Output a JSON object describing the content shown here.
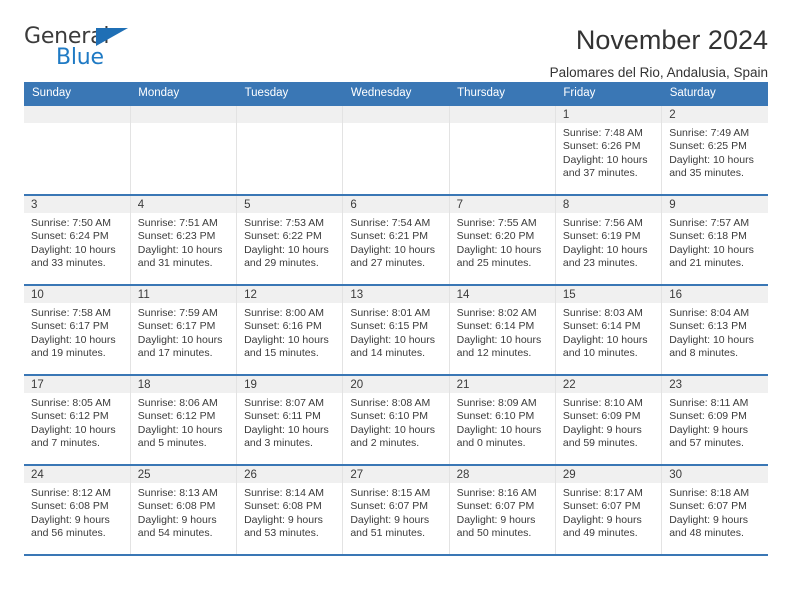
{
  "brand": {
    "name_part1": "General",
    "name_part2": "Blue"
  },
  "header": {
    "title": "November 2024",
    "subtitle": "Palomares del Rio, Andalusia, Spain"
  },
  "colors": {
    "header_blue": "#3a77b5",
    "brand_blue": "#1f7ac4",
    "daynum_band": "#f0f0f0",
    "text": "#3b3b3b"
  },
  "weekdays": [
    "Sunday",
    "Monday",
    "Tuesday",
    "Wednesday",
    "Thursday",
    "Friday",
    "Saturday"
  ],
  "weeks": [
    [
      {
        "day": "",
        "empty": true
      },
      {
        "day": "",
        "empty": true
      },
      {
        "day": "",
        "empty": true
      },
      {
        "day": "",
        "empty": true
      },
      {
        "day": "",
        "empty": true
      },
      {
        "day": "1",
        "sunrise": "Sunrise: 7:48 AM",
        "sunset": "Sunset: 6:26 PM",
        "daylight": "Daylight: 10 hours and 37 minutes."
      },
      {
        "day": "2",
        "sunrise": "Sunrise: 7:49 AM",
        "sunset": "Sunset: 6:25 PM",
        "daylight": "Daylight: 10 hours and 35 minutes."
      }
    ],
    [
      {
        "day": "3",
        "sunrise": "Sunrise: 7:50 AM",
        "sunset": "Sunset: 6:24 PM",
        "daylight": "Daylight: 10 hours and 33 minutes."
      },
      {
        "day": "4",
        "sunrise": "Sunrise: 7:51 AM",
        "sunset": "Sunset: 6:23 PM",
        "daylight": "Daylight: 10 hours and 31 minutes."
      },
      {
        "day": "5",
        "sunrise": "Sunrise: 7:53 AM",
        "sunset": "Sunset: 6:22 PM",
        "daylight": "Daylight: 10 hours and 29 minutes."
      },
      {
        "day": "6",
        "sunrise": "Sunrise: 7:54 AM",
        "sunset": "Sunset: 6:21 PM",
        "daylight": "Daylight: 10 hours and 27 minutes."
      },
      {
        "day": "7",
        "sunrise": "Sunrise: 7:55 AM",
        "sunset": "Sunset: 6:20 PM",
        "daylight": "Daylight: 10 hours and 25 minutes."
      },
      {
        "day": "8",
        "sunrise": "Sunrise: 7:56 AM",
        "sunset": "Sunset: 6:19 PM",
        "daylight": "Daylight: 10 hours and 23 minutes."
      },
      {
        "day": "9",
        "sunrise": "Sunrise: 7:57 AM",
        "sunset": "Sunset: 6:18 PM",
        "daylight": "Daylight: 10 hours and 21 minutes."
      }
    ],
    [
      {
        "day": "10",
        "sunrise": "Sunrise: 7:58 AM",
        "sunset": "Sunset: 6:17 PM",
        "daylight": "Daylight: 10 hours and 19 minutes."
      },
      {
        "day": "11",
        "sunrise": "Sunrise: 7:59 AM",
        "sunset": "Sunset: 6:17 PM",
        "daylight": "Daylight: 10 hours and 17 minutes."
      },
      {
        "day": "12",
        "sunrise": "Sunrise: 8:00 AM",
        "sunset": "Sunset: 6:16 PM",
        "daylight": "Daylight: 10 hours and 15 minutes."
      },
      {
        "day": "13",
        "sunrise": "Sunrise: 8:01 AM",
        "sunset": "Sunset: 6:15 PM",
        "daylight": "Daylight: 10 hours and 14 minutes."
      },
      {
        "day": "14",
        "sunrise": "Sunrise: 8:02 AM",
        "sunset": "Sunset: 6:14 PM",
        "daylight": "Daylight: 10 hours and 12 minutes."
      },
      {
        "day": "15",
        "sunrise": "Sunrise: 8:03 AM",
        "sunset": "Sunset: 6:14 PM",
        "daylight": "Daylight: 10 hours and 10 minutes."
      },
      {
        "day": "16",
        "sunrise": "Sunrise: 8:04 AM",
        "sunset": "Sunset: 6:13 PM",
        "daylight": "Daylight: 10 hours and 8 minutes."
      }
    ],
    [
      {
        "day": "17",
        "sunrise": "Sunrise: 8:05 AM",
        "sunset": "Sunset: 6:12 PM",
        "daylight": "Daylight: 10 hours and 7 minutes."
      },
      {
        "day": "18",
        "sunrise": "Sunrise: 8:06 AM",
        "sunset": "Sunset: 6:12 PM",
        "daylight": "Daylight: 10 hours and 5 minutes."
      },
      {
        "day": "19",
        "sunrise": "Sunrise: 8:07 AM",
        "sunset": "Sunset: 6:11 PM",
        "daylight": "Daylight: 10 hours and 3 minutes."
      },
      {
        "day": "20",
        "sunrise": "Sunrise: 8:08 AM",
        "sunset": "Sunset: 6:10 PM",
        "daylight": "Daylight: 10 hours and 2 minutes."
      },
      {
        "day": "21",
        "sunrise": "Sunrise: 8:09 AM",
        "sunset": "Sunset: 6:10 PM",
        "daylight": "Daylight: 10 hours and 0 minutes."
      },
      {
        "day": "22",
        "sunrise": "Sunrise: 8:10 AM",
        "sunset": "Sunset: 6:09 PM",
        "daylight": "Daylight: 9 hours and 59 minutes."
      },
      {
        "day": "23",
        "sunrise": "Sunrise: 8:11 AM",
        "sunset": "Sunset: 6:09 PM",
        "daylight": "Daylight: 9 hours and 57 minutes."
      }
    ],
    [
      {
        "day": "24",
        "sunrise": "Sunrise: 8:12 AM",
        "sunset": "Sunset: 6:08 PM",
        "daylight": "Daylight: 9 hours and 56 minutes."
      },
      {
        "day": "25",
        "sunrise": "Sunrise: 8:13 AM",
        "sunset": "Sunset: 6:08 PM",
        "daylight": "Daylight: 9 hours and 54 minutes."
      },
      {
        "day": "26",
        "sunrise": "Sunrise: 8:14 AM",
        "sunset": "Sunset: 6:08 PM",
        "daylight": "Daylight: 9 hours and 53 minutes."
      },
      {
        "day": "27",
        "sunrise": "Sunrise: 8:15 AM",
        "sunset": "Sunset: 6:07 PM",
        "daylight": "Daylight: 9 hours and 51 minutes."
      },
      {
        "day": "28",
        "sunrise": "Sunrise: 8:16 AM",
        "sunset": "Sunset: 6:07 PM",
        "daylight": "Daylight: 9 hours and 50 minutes."
      },
      {
        "day": "29",
        "sunrise": "Sunrise: 8:17 AM",
        "sunset": "Sunset: 6:07 PM",
        "daylight": "Daylight: 9 hours and 49 minutes."
      },
      {
        "day": "30",
        "sunrise": "Sunrise: 8:18 AM",
        "sunset": "Sunset: 6:07 PM",
        "daylight": "Daylight: 9 hours and 48 minutes."
      }
    ]
  ]
}
